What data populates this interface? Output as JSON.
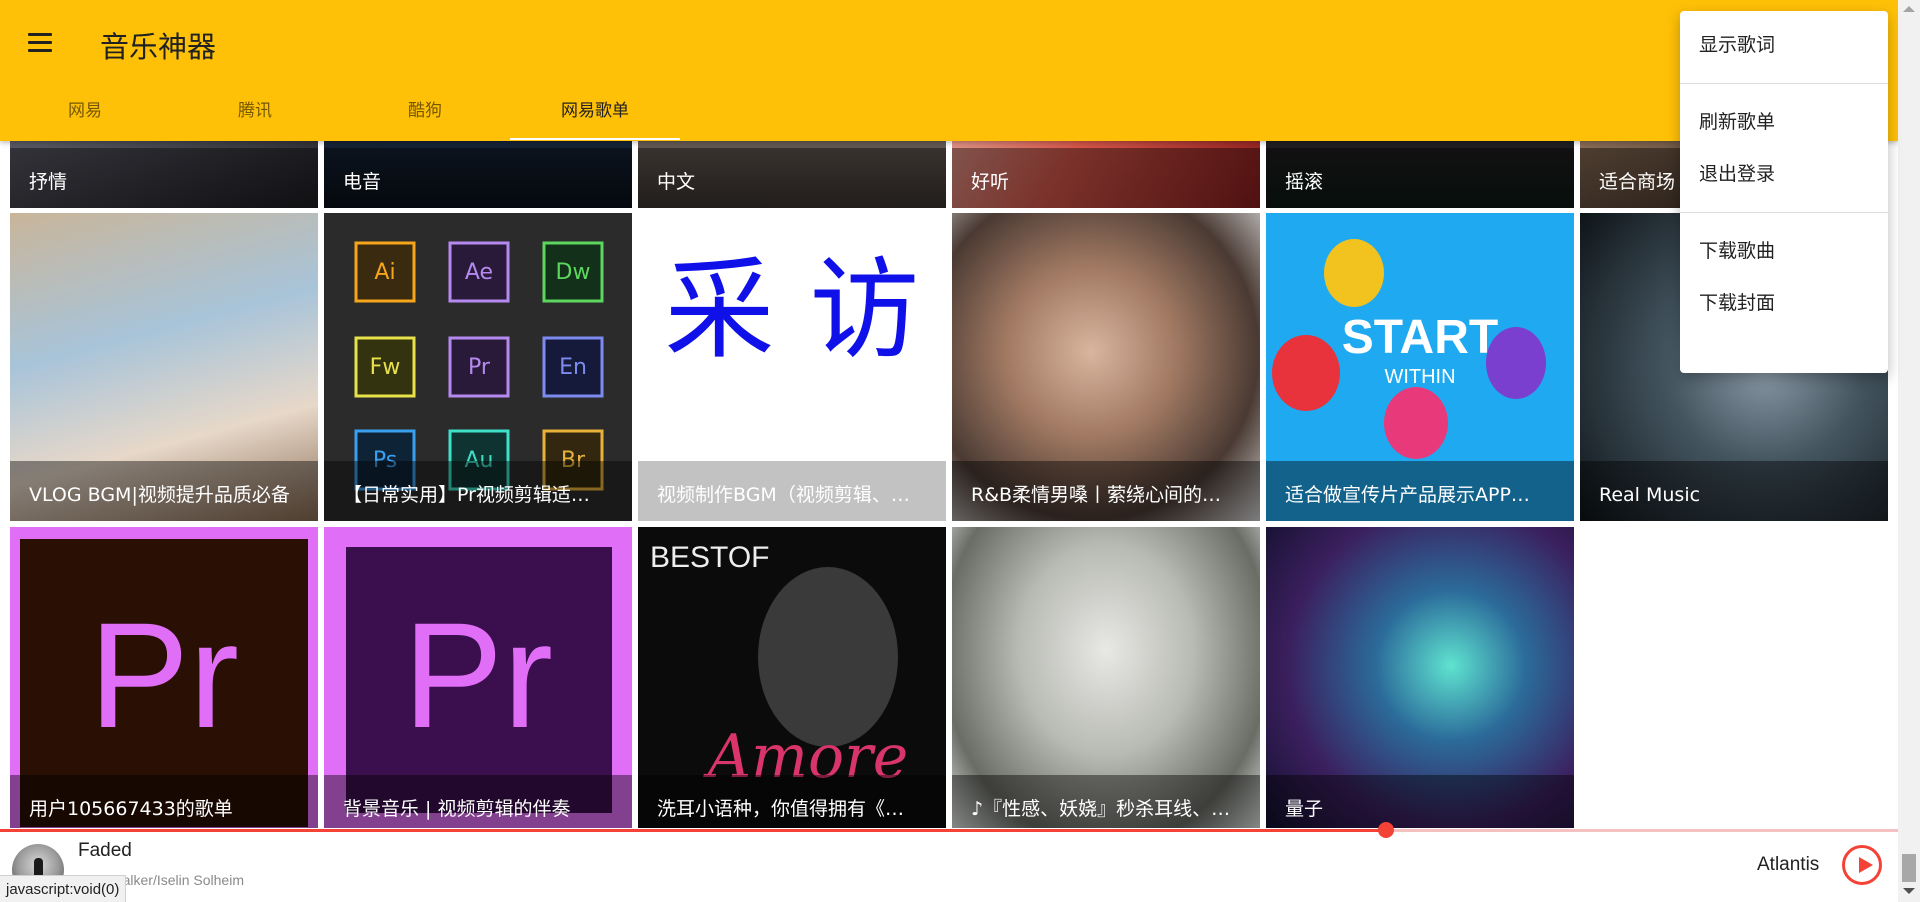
{
  "app": {
    "title": "音乐神器"
  },
  "tabs": [
    {
      "label": "网易"
    },
    {
      "label": "腾讯"
    },
    {
      "label": "酷狗"
    },
    {
      "label": "网易歌单"
    }
  ],
  "menu": {
    "items": [
      {
        "label": "显示歌词"
      },
      {
        "label": "刷新歌单"
      },
      {
        "label": "退出登录"
      },
      {
        "label": "下载歌曲"
      },
      {
        "label": "下载封面"
      }
    ]
  },
  "playlists": {
    "row1": [
      {
        "title": "抒情"
      },
      {
        "title": "电音"
      },
      {
        "title": "中文"
      },
      {
        "title": "好听"
      },
      {
        "title": "摇滚"
      },
      {
        "title": "适合商场"
      }
    ],
    "row2": [
      {
        "title": "VLOG BGM|视频提升品质必备"
      },
      {
        "title": "【日常实用】Pr视频剪辑适…"
      },
      {
        "title": "视频制作BGM（视频剪辑、…"
      },
      {
        "title": "R&B柔情男嗓丨萦绕心间的…"
      },
      {
        "title": "适合做宣传片产品展示APP…"
      },
      {
        "title": "Real Music"
      }
    ],
    "row3": [
      {
        "title": "用户105667433的歌单"
      },
      {
        "title": "背景音乐 | 视频剪辑的伴奏"
      },
      {
        "title": "洗耳小语种，你值得拥有《…"
      },
      {
        "title": "♪『性感、妖娆』秒杀耳线、…"
      },
      {
        "title": "量子"
      }
    ]
  },
  "tile_art_text": {
    "caifang": "采 访",
    "start": "START",
    "within": "WITHIN",
    "pr": "Pr",
    "bestof": "BESTOF",
    "amore": "Amore",
    "adobe": [
      "Ai",
      "Ae",
      "Dw",
      "Fw",
      "Pr",
      "En",
      "Ps",
      "Au",
      "Br"
    ]
  },
  "player": {
    "song": "Faded",
    "artist": "Alan Walker/Iselin Solheim",
    "next_song": "Atlantis",
    "progress": 0.73
  },
  "status_bar": {
    "text": "javascript:void(0)"
  },
  "colors": {
    "header": "#ffc107",
    "accent": "#f44336"
  }
}
